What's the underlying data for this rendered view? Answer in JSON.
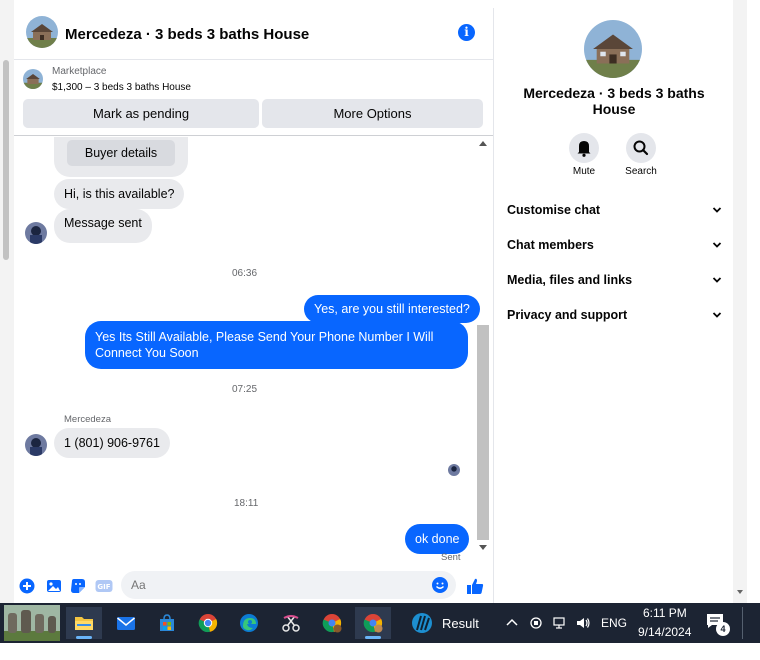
{
  "conversation": {
    "title": "Mercedeza · 3 beds 3 baths House",
    "marketplace_label": "Marketplace",
    "listing_price": "$1,300 – 3 beds 3 baths House",
    "mark_pending_label": "Mark as pending",
    "more_options_label": "More Options"
  },
  "messages": {
    "buyer_details_label": "Buyer details",
    "m1": "Hi, is this available?",
    "m2": "Message sent",
    "t1": "06:36",
    "m3": "Yes, are you still interested?",
    "m4": "Yes Its Still Available, Please Send Your Phone Number I Will Connect You Soon",
    "t2": "07:25",
    "sender_name": "Mercedeza",
    "m5": "1 (801) 906-9761",
    "t3": "18:11",
    "m6": "ok done",
    "sent_status": "Sent"
  },
  "composer": {
    "placeholder": "Aa"
  },
  "info_panel": {
    "name": "Mercedeza · 3 beds 3 baths House",
    "mute_label": "Mute",
    "search_label": "Search",
    "sections": [
      "Customise chat",
      "Chat members",
      "Media, files and links",
      "Privacy and support"
    ]
  },
  "taskbar": {
    "app_label": "Result",
    "language": "ENG",
    "time": "6:11 PM",
    "date": "9/14/2024",
    "notification_count": "4"
  },
  "colors": {
    "accent": "#0866ff",
    "incoming_bubble": "#e9eaed",
    "taskbar": "#1c2433"
  }
}
